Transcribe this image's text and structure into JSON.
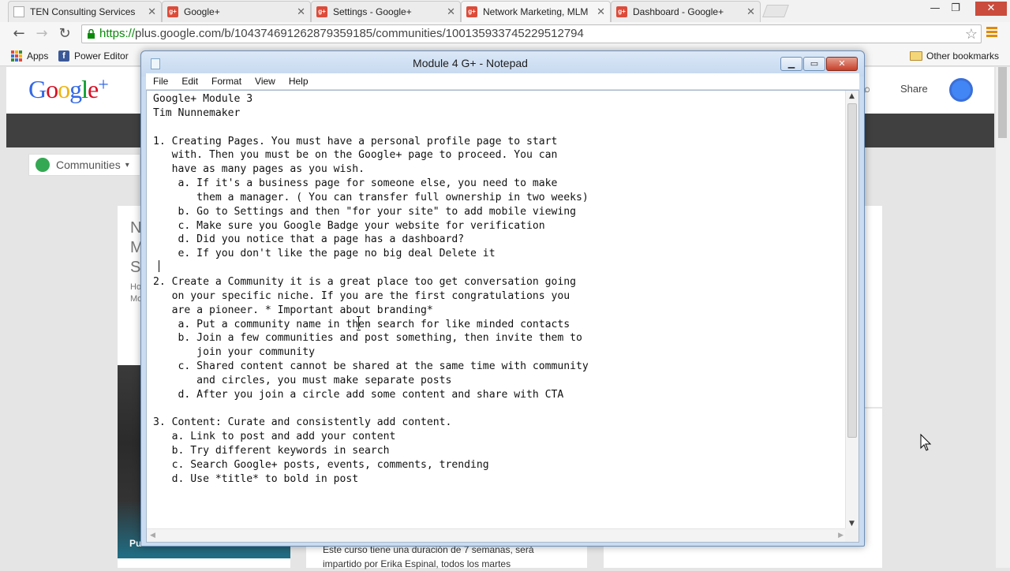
{
  "browser": {
    "tabs": [
      {
        "label": "TEN Consulting Services",
        "favicon": "doc-icon"
      },
      {
        "label": "Google+",
        "favicon": "gplus-icon"
      },
      {
        "label": "Settings - Google+",
        "favicon": "gplus-icon"
      },
      {
        "label": "Network Marketing, MLM",
        "favicon": "gplus-icon",
        "active": true
      },
      {
        "label": "Dashboard - Google+",
        "favicon": "gplus-icon"
      }
    ],
    "url_protocol": "https://",
    "url_rest": "plus.google.com/b/104374691262879359185/communities/100135933745229512794",
    "bookmarks": {
      "apps": "Apps",
      "power_editor": "Power Editor",
      "other": "Other bookmarks"
    }
  },
  "gplus_page": {
    "share": "Share",
    "communities": "Communities",
    "left_letters": [
      "N",
      "M",
      "S"
    ],
    "left_small": [
      "Ho",
      "Mo"
    ],
    "photo_label": "Pu",
    "mid_text_1": "Este curso tiene una duración de 7 semanas, será",
    "mid_text_2": "impartido por Erika Espinal, todos los martes"
  },
  "notepad": {
    "title": "Module 4 G+ - Notepad",
    "menu": [
      "File",
      "Edit",
      "Format",
      "View",
      "Help"
    ],
    "lines": [
      "Google+ Module 3",
      "Tim Nunnemaker",
      "",
      "1. Creating Pages. You must have a personal profile page to start",
      "   with. Then you must be on the Google+ page to proceed. You can",
      "   have as many pages as you wish.",
      "    a. If it's a business page for someone else, you need to make",
      "       them a manager. ( You can transfer full ownership in two weeks)",
      "    b. Go to Settings and then \"for your site\" to add mobile viewing",
      "    c. Make sure you Google Badge your website for verification",
      "    d. Did you notice that a page has a dashboard?",
      "    e. If you don't like the page no big deal Delete it",
      "",
      "2. Create a Community it is a great place too get conversation going",
      "   on your specific niche. If you are the first congratulations you",
      "   are a pioneer. * Important about branding*",
      "    a. Put a community name in then search for like minded contacts",
      "    b. Join a few communities and post something, then invite them to",
      "       join your community",
      "    c. Shared content cannot be shared at the same time with community",
      "       and circles, you must make separate posts",
      "    d. After you join a circle add some content and share with CTA",
      "",
      "3. Content: Curate and consistently add content.",
      "   a. Link to post and add your content",
      "   b. Try different keywords in search",
      "   c. Search Google+ posts, events, comments, trending",
      "   d. Use *title* to bold in post"
    ]
  }
}
